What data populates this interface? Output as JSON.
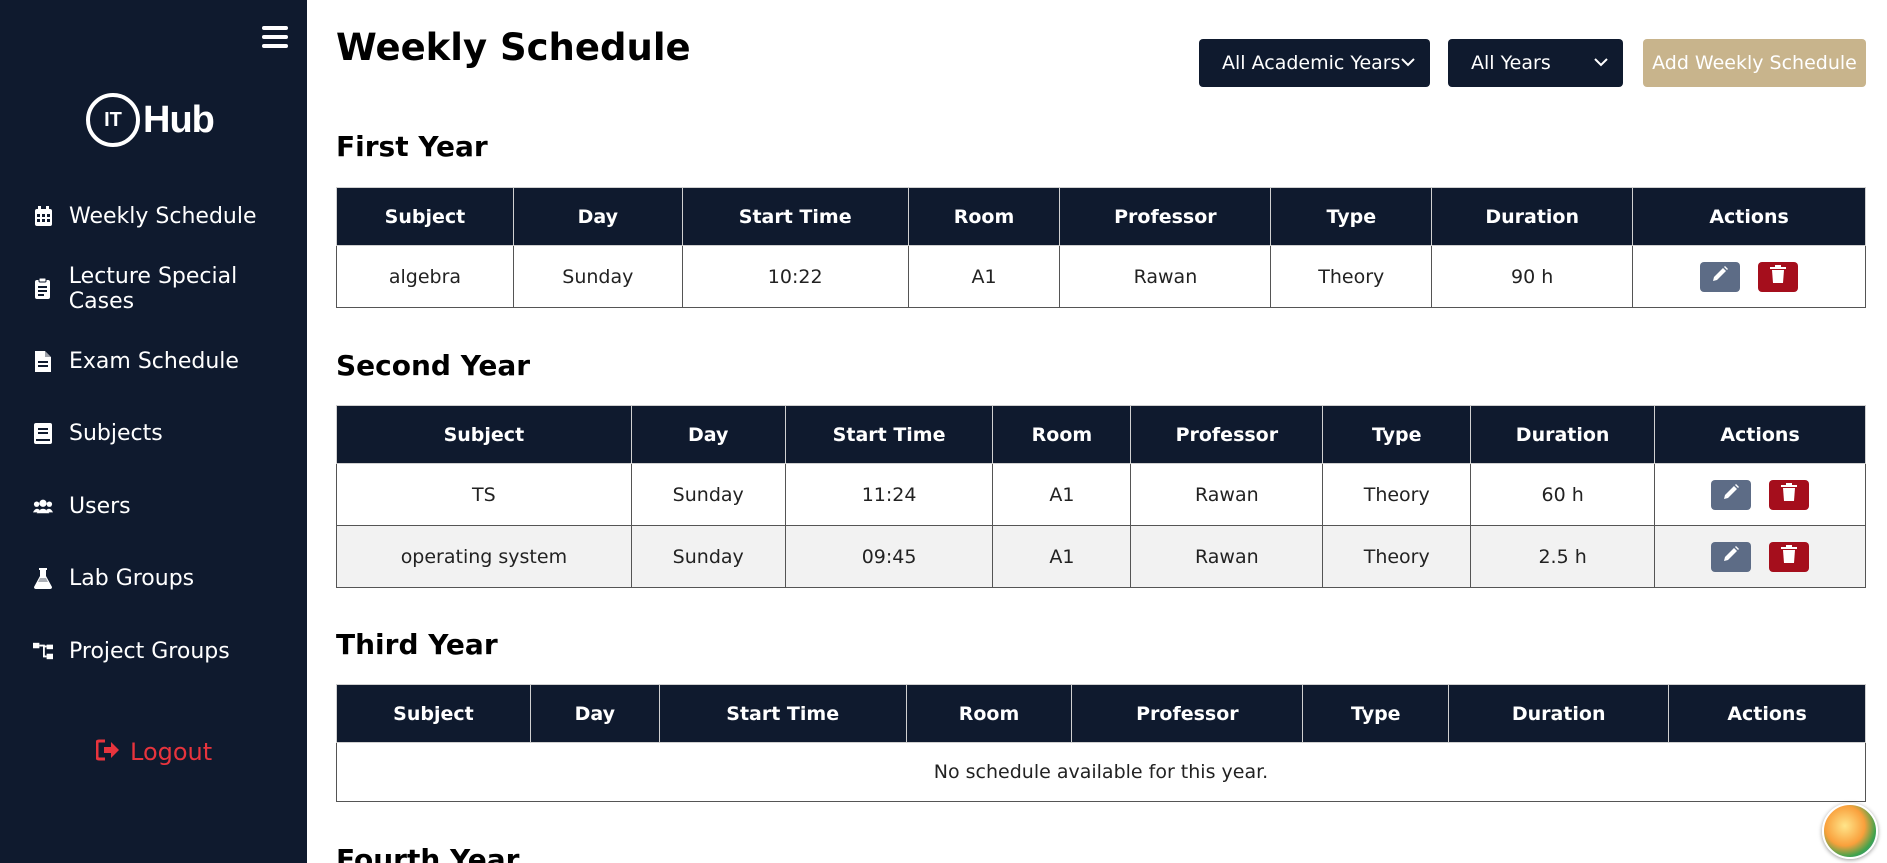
{
  "app": {
    "logo_mark": "IT",
    "logo_text": "Hub"
  },
  "sidebar": {
    "items": [
      {
        "label": "Weekly Schedule",
        "icon": "calendar-icon"
      },
      {
        "label": "Lecture Special Cases",
        "icon": "clipboard-icon"
      },
      {
        "label": "Exam Schedule",
        "icon": "file-icon"
      },
      {
        "label": "Subjects",
        "icon": "book-icon"
      },
      {
        "label": "Users",
        "icon": "users-icon"
      },
      {
        "label": "Lab Groups",
        "icon": "flask-icon"
      },
      {
        "label": "Project Groups",
        "icon": "sitemap-icon"
      }
    ],
    "logout_label": "Logout"
  },
  "header": {
    "title": "Weekly Schedule",
    "academic_year_select": "All Academic Years",
    "year_select": "All Years",
    "add_button": "Add Weekly Schedule"
  },
  "columns": [
    "Subject",
    "Day",
    "Start Time",
    "Room",
    "Professor",
    "Type",
    "Duration",
    "Actions"
  ],
  "sections": [
    {
      "title": "First Year",
      "rows": [
        {
          "subject": "algebra",
          "day": "Sunday",
          "start": "10:22",
          "room": "A1",
          "professor": "Rawan",
          "type": "Theory",
          "duration": "90 h"
        }
      ]
    },
    {
      "title": "Second Year",
      "rows": [
        {
          "subject": "TS",
          "day": "Sunday",
          "start": "11:24",
          "room": "A1",
          "professor": "Rawan",
          "type": "Theory",
          "duration": "60 h"
        },
        {
          "subject": "operating system",
          "day": "Sunday",
          "start": "09:45",
          "room": "A1",
          "professor": "Rawan",
          "type": "Theory",
          "duration": "2.5 h"
        }
      ]
    },
    {
      "title": "Third Year",
      "empty_message": "No schedule available for this year."
    },
    {
      "title": "Fourth Year"
    }
  ],
  "colors": {
    "sidebar_bg": "#0f1a2e",
    "header_bg": "#0f1a2e",
    "add_button": "#c8b48c",
    "edit_button": "#5d6c86",
    "delete_button": "#a50e1c",
    "logout": "#e8343d"
  }
}
